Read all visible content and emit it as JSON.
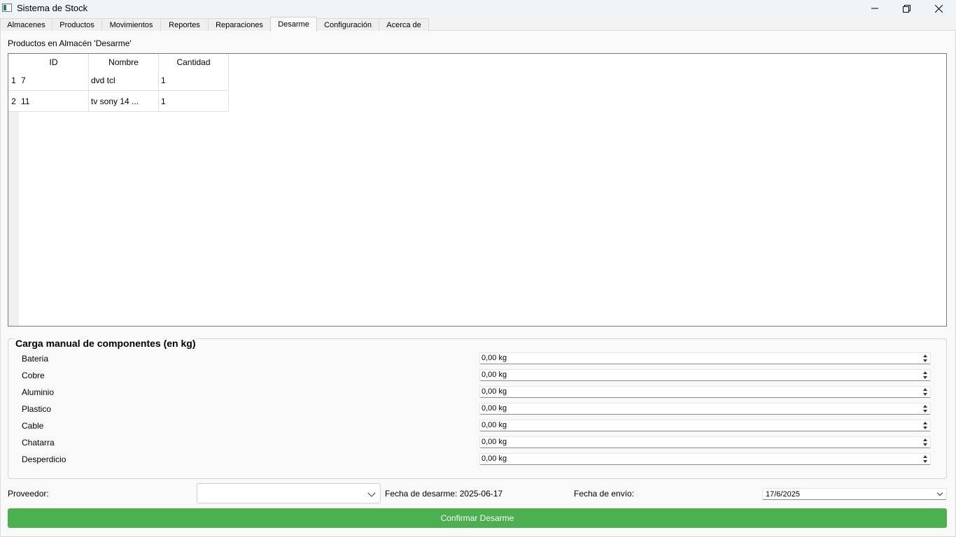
{
  "window": {
    "title": "Sistema de Stock"
  },
  "tabs": [
    {
      "label": "Almacenes"
    },
    {
      "label": "Productos"
    },
    {
      "label": "Movimientos"
    },
    {
      "label": "Reportes"
    },
    {
      "label": "Reparaciones"
    },
    {
      "label": "Desarme",
      "active": true
    },
    {
      "label": "Configuración"
    },
    {
      "label": "Acerca de"
    }
  ],
  "products": {
    "title": "Productos en Almacén 'Desarme'",
    "columns": [
      "ID",
      "Nombre",
      "Cantidad"
    ],
    "rows": [
      {
        "num": "1",
        "id": "7",
        "nombre": "dvd tcl",
        "cantidad": "1"
      },
      {
        "num": "2",
        "id": "11",
        "nombre": "tv sony 14 ...",
        "cantidad": "1"
      }
    ]
  },
  "components": {
    "title": "Carga manual de componentes (en kg)",
    "items": [
      {
        "label": "Bateria",
        "value": "0,00 kg"
      },
      {
        "label": "Cobre",
        "value": "0,00 kg"
      },
      {
        "label": "Aluminio",
        "value": "0,00 kg"
      },
      {
        "label": "Plastico",
        "value": "0,00 kg"
      },
      {
        "label": "Cable",
        "value": "0,00 kg"
      },
      {
        "label": "Chatarra",
        "value": "0,00 kg"
      },
      {
        "label": "Desperdicio",
        "value": "0,00 kg"
      }
    ]
  },
  "form": {
    "proveedor_label": "Proveedor:",
    "proveedor_value": "",
    "fecha_desarme": "Fecha de desarme: 2025-06-17",
    "fecha_envio_label": "Fecha de envío:",
    "fecha_envio_value": "17/6/2025"
  },
  "actions": {
    "confirm_label": "Confirmar Desarme"
  },
  "colors": {
    "confirm_button": "#4caf50"
  }
}
